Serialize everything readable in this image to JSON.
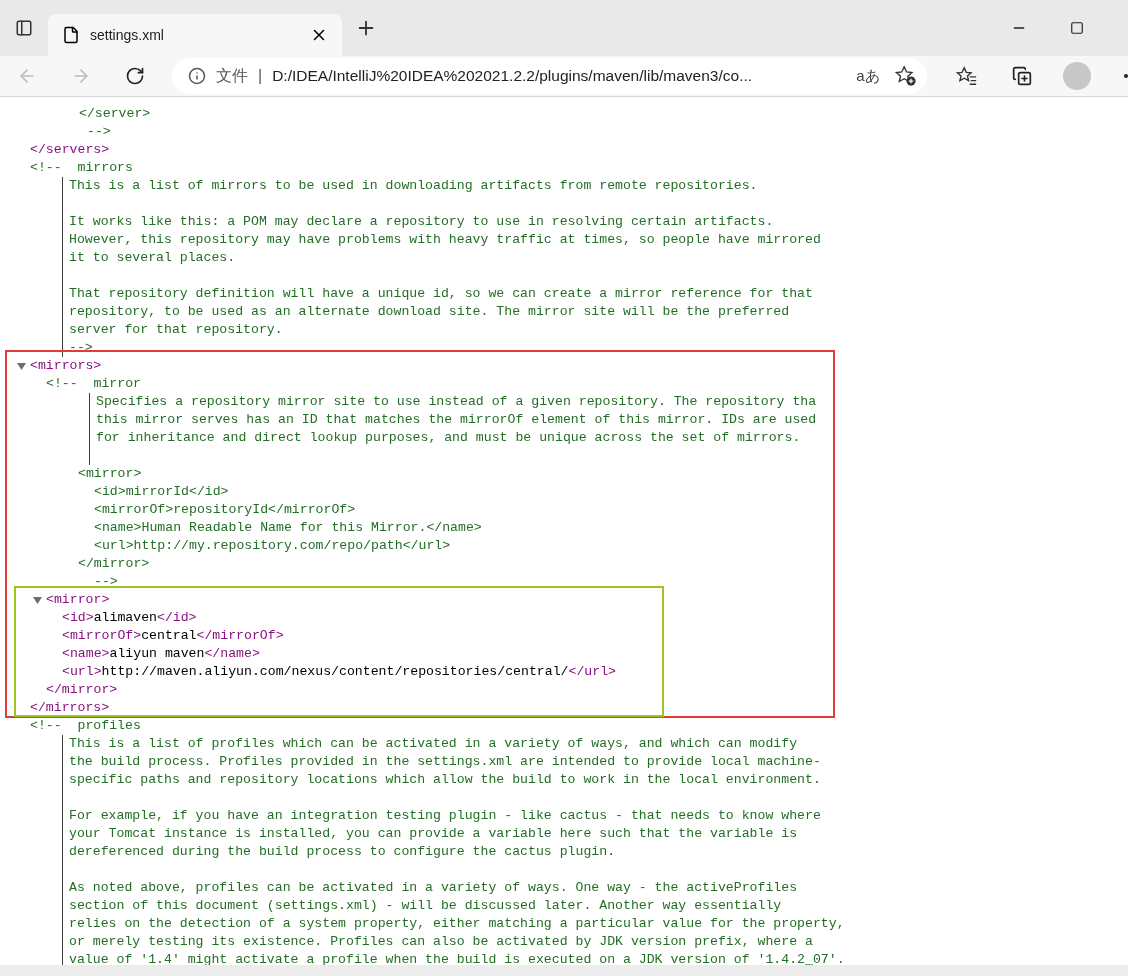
{
  "browser": {
    "tab": {
      "title": "settings.xml",
      "selected": true
    },
    "back_disabled": true,
    "forward_disabled": true,
    "address": {
      "scheme_label": "文件",
      "separator": "|",
      "url": "D:/IDEA/IntelliJ%20IDEA%202021.2.2/plugins/maven/lib/maven3/co..."
    },
    "read_aloud_glyph": "aあ"
  },
  "xml": [
    {
      "kind": "fragment",
      "lines": [
        {
          "text": "</server>"
        }
      ],
      "tail": "-->"
    },
    {
      "kind": "close",
      "tag": "</servers>"
    },
    {
      "kind": "comment",
      "label": "<!--  mirrors",
      "paragraphs": [
        [
          "This is a list of mirrors to be used in downloading artifacts from remote repositories."
        ],
        [
          "It works like this: a POM may declare a repository to use in resolving certain artifacts.",
          "However, this repository may have problems with heavy traffic at times, so people have mirrored",
          "it to several places."
        ],
        [
          "That repository definition will have a unique id, so we can create a mirror reference for that",
          "repository, to be used as an alternate download site. The mirror site will be the preferred",
          "server for that repository."
        ]
      ],
      "tail": "-->"
    },
    {
      "kind": "element",
      "open_tag": "<mirrors>",
      "close_tag": "</mirrors>",
      "expanded": true,
      "frame": {
        "color": "#e5383d"
      },
      "children": [
        {
          "kind": "comment",
          "label": "<!--  mirror",
          "paragraphs": [
            [
              "Specifies a repository mirror site to use instead of a given repository. The repository tha",
              "this mirror serves has an ID that matches the mirrorOf element of this mirror. IDs are used",
              "for inheritance and direct lookup purposes, and must be unique across the set of mirrors."
            ]
          ],
          "trailing_blank": true,
          "after": [
            {
              "text": "<mirror>",
              "children": [
                {
                  "text": "<id>mirrorId</id>"
                },
                {
                  "text": "<mirrorOf>repositoryId</mirrorOf>"
                },
                {
                  "text": "<name>Human Readable Name for this Mirror.</name>"
                },
                {
                  "text": "<url>http://my.repository.com/repo/path</url>"
                }
              ]
            },
            {
              "text": "</mirror>"
            }
          ],
          "tail": "-->"
        },
        {
          "kind": "element",
          "open_tag": "<mirror>",
          "close_tag": "</mirror>",
          "expanded": true,
          "frame": {
            "color": "#9fc41c"
          },
          "children": [
            {
              "kind": "leaf",
              "open_tag": "<id>",
              "text": "alimaven",
              "close_tag": "</id>"
            },
            {
              "kind": "leaf",
              "open_tag": "<mirrorOf>",
              "text": "central",
              "close_tag": "</mirrorOf>"
            },
            {
              "kind": "leaf",
              "open_tag": "<name>",
              "text": "aliyun maven",
              "close_tag": "</name>"
            },
            {
              "kind": "leaf",
              "open_tag": "<url>",
              "text": "http://maven.aliyun.com/nexus/content/repositories/central/",
              "close_tag": "</url>"
            }
          ]
        }
      ]
    },
    {
      "kind": "comment",
      "label": "<!--  profiles",
      "paragraphs": [
        [
          "This is a list of profiles which can be activated in a variety of ways, and which can modify",
          "the build process. Profiles provided in the settings.xml are intended to provide local machine-",
          "specific paths and repository locations which allow the build to work in the local environment."
        ],
        [
          "For example, if you have an integration testing plugin - like cactus - that needs to know where",
          "your Tomcat instance is installed, you can provide a variable here such that the variable is",
          "dereferenced during the build process to configure the cactus plugin."
        ],
        [
          "As noted above, profiles can be activated in a variety of ways. One way - the activeProfiles",
          "section of this document (settings.xml) - will be discussed later. Another way essentially",
          "relies on the detection of a system property, either matching a particular value for the property,",
          "or merely testing its existence. Profiles can also be activated by JDK version prefix, where a",
          "value of '1.4' might activate a profile when the build is executed on a JDK version of '1.4.2_07'."
        ]
      ]
    }
  ]
}
